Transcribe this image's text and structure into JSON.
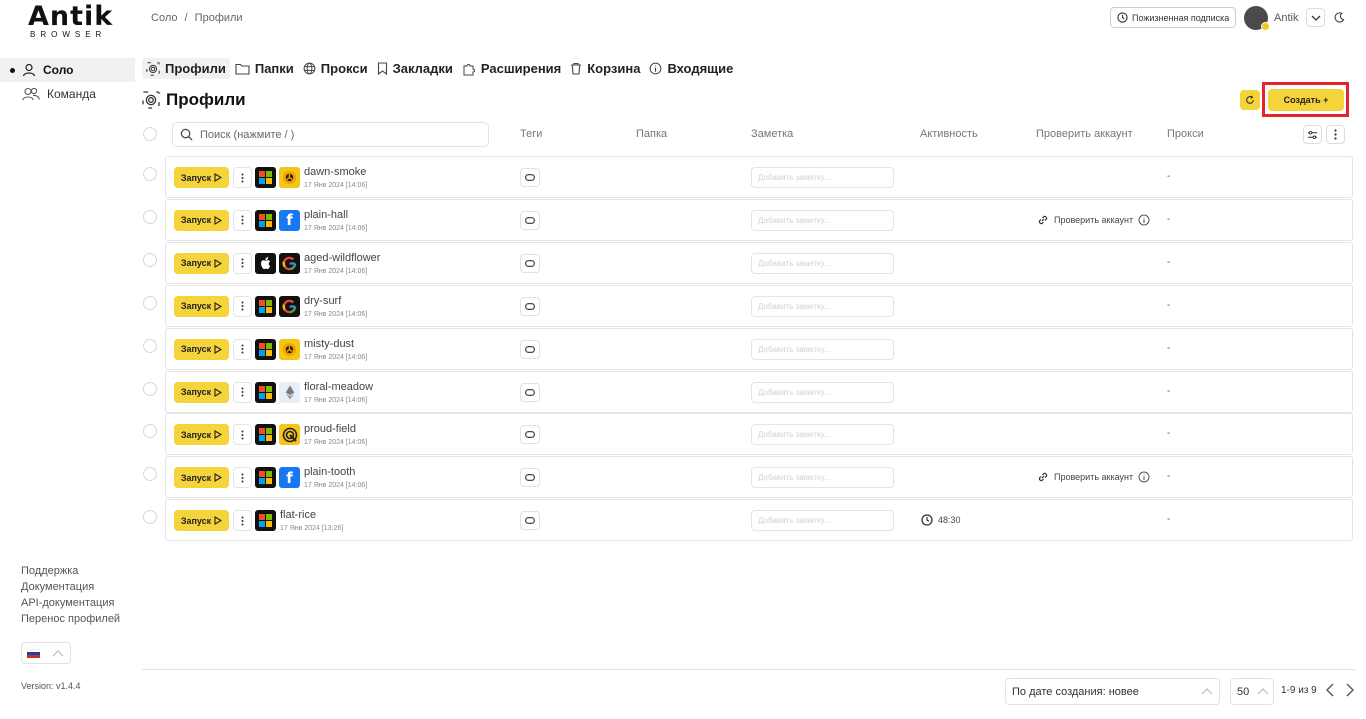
{
  "logo": {
    "main": "Antik",
    "sub": "BROWSER"
  },
  "sidebar": {
    "items": [
      {
        "label": "Соло",
        "active": true
      },
      {
        "label": "Команда",
        "active": false
      }
    ],
    "links": [
      "Поддержка",
      "Документация",
      "API-документация",
      "Перенос профилей"
    ],
    "version": "Version: v1.4.4"
  },
  "header": {
    "breadcrumb": [
      "Соло",
      "/",
      "Профили"
    ],
    "subscription": "Пожизненная подписка",
    "user_name": "Antik"
  },
  "tabs": [
    {
      "label": "Профили",
      "icon": "fingerprint-icon",
      "active": true
    },
    {
      "label": "Папки",
      "icon": "folder-icon"
    },
    {
      "label": "Прокси",
      "icon": "globe-icon"
    },
    {
      "label": "Закладки",
      "icon": "bookmark-icon"
    },
    {
      "label": "Расширения",
      "icon": "puzzle-icon"
    },
    {
      "label": "Корзина",
      "icon": "trash-icon"
    },
    {
      "label": "Входящие",
      "icon": "info-icon"
    }
  ],
  "page_title": "Профили",
  "create_label": "Создать +",
  "search": {
    "placeholder": "Поиск (нажмите / )",
    "value": ""
  },
  "columns": [
    "Теги",
    "Папка",
    "Заметка",
    "Активность",
    "Проверить аккаунт",
    "Прокси"
  ],
  "launch_label": "Запуск",
  "note_placeholder": "Добавить заметку...",
  "check_label": "Проверить аккаунт",
  "profiles": [
    {
      "name": "dawn-smoke",
      "date": "17 Янв 2024 [14:06]",
      "os": "windows",
      "browser": "yandex",
      "activity": "",
      "check": false,
      "proxy": "-"
    },
    {
      "name": "plain-hall",
      "date": "17 Янв 2024 [14:06]",
      "os": "windows",
      "browser": "facebook",
      "activity": "",
      "check": true,
      "proxy": "-"
    },
    {
      "name": "aged-wildflower",
      "date": "17 Янв 2024 [14:06]",
      "os": "mac",
      "browser": "google",
      "activity": "",
      "check": false,
      "proxy": "-"
    },
    {
      "name": "dry-surf",
      "date": "17 Янв 2024 [14:06]",
      "os": "windows",
      "browser": "google",
      "activity": "",
      "check": false,
      "proxy": "-"
    },
    {
      "name": "misty-dust",
      "date": "17 Янв 2024 [14:06]",
      "os": "windows",
      "browser": "yandex",
      "activity": "",
      "check": false,
      "proxy": "-"
    },
    {
      "name": "floral-meadow",
      "date": "17 Янв 2024 [14:06]",
      "os": "windows",
      "browser": "ethereum",
      "activity": "",
      "check": false,
      "proxy": "-"
    },
    {
      "name": "proud-field",
      "date": "17 Янв 2024 [14:06]",
      "os": "windows",
      "browser": "target",
      "activity": "",
      "check": false,
      "proxy": "-"
    },
    {
      "name": "plain-tooth",
      "date": "17 Янв 2024 [14:06]",
      "os": "windows",
      "browser": "facebook",
      "activity": "",
      "check": true,
      "proxy": "-"
    },
    {
      "name": "flat-rice",
      "date": "17 Янв 2024 [13:26]",
      "os": "windows",
      "browser": "",
      "activity": "48:30",
      "check": false,
      "proxy": "-"
    }
  ],
  "footer": {
    "sort": "По дате создания: новее",
    "per_page": "50",
    "pagination": "1-9 из 9"
  },
  "colors": {
    "accent": "#f5d33a",
    "highlight_border": "#e3242b"
  }
}
